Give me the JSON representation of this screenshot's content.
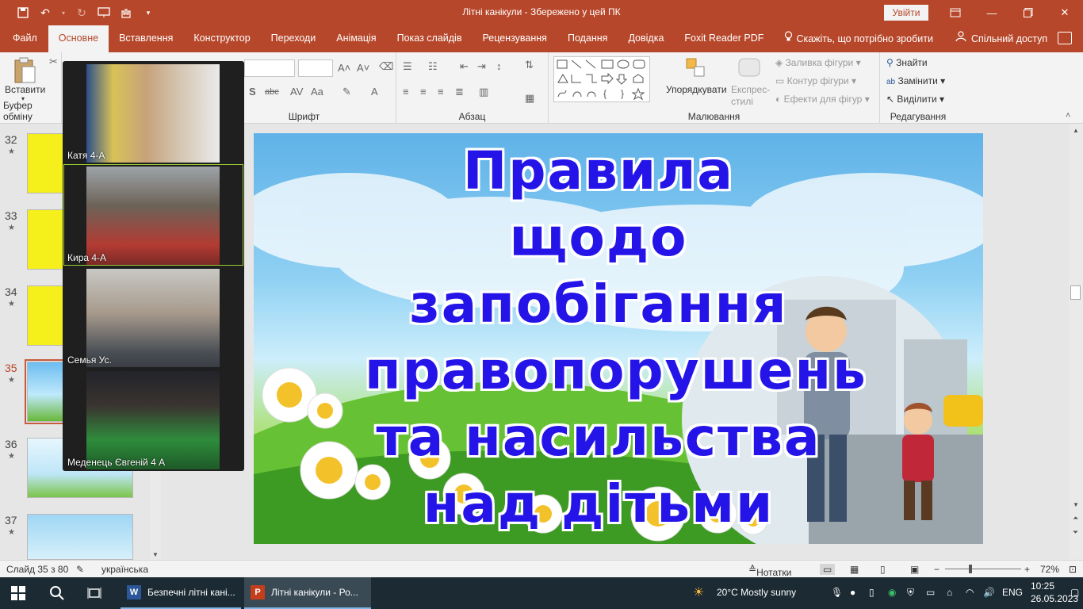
{
  "titlebar": {
    "document_title": "Літні канікули  -  Збережено у цей ПК",
    "signin_label": "Увійти",
    "accent_color": "#b7472a"
  },
  "tabs": [
    {
      "label": "Файл"
    },
    {
      "label": "Основне"
    },
    {
      "label": "Вставлення"
    },
    {
      "label": "Конструктор"
    },
    {
      "label": "Переходи"
    },
    {
      "label": "Анімація"
    },
    {
      "label": "Показ слайдів"
    },
    {
      "label": "Рецензування"
    },
    {
      "label": "Подання"
    },
    {
      "label": "Довідка"
    },
    {
      "label": "Foxit Reader PDF"
    }
  ],
  "tell_me": "Скажіть, що потрібно зробити",
  "share_label": "Спільний доступ",
  "ribbon": {
    "clipboard": {
      "paste_label": "Вставити",
      "group_label": "Буфер обміну"
    },
    "font": {
      "group_label": "Шрифт"
    },
    "paragraph": {
      "group_label": "Абзац"
    },
    "drawing": {
      "group_label": "Малювання",
      "arrange_label": "Упорядкувати",
      "quick_styles_label": "Експрес-стилі",
      "fill_label": "Заливка фігури",
      "outline_label": "Контур фігури",
      "effects_label": "Ефекти для фігур"
    },
    "editing": {
      "group_label": "Редагування",
      "find_label": "Знайти",
      "replace_label": "Замінити",
      "select_label": "Виділити"
    }
  },
  "thumbnails": [
    {
      "number": "32",
      "bg": "#f5ef1c"
    },
    {
      "number": "33",
      "bg": "#f5ef1c"
    },
    {
      "number": "34",
      "bg": "#f5ef1c"
    },
    {
      "number": "35",
      "bg": "#7fc7ef",
      "selected": true
    },
    {
      "number": "36",
      "bg": "#d9f0fb"
    },
    {
      "number": "37",
      "bg": "#bfe4f7"
    }
  ],
  "video": {
    "participants": [
      {
        "name": "Катя  4-А"
      },
      {
        "name": "Кира 4-А",
        "speaking": true
      },
      {
        "name": "Семья Ус."
      },
      {
        "name": "Меденець Євгеній 4 А"
      }
    ]
  },
  "slide": {
    "title_lines": [
      "Правила щодо",
      "запобігання",
      "правопорушень",
      "та насильства",
      "над дітьми"
    ],
    "title_color": "#2414e8"
  },
  "status": {
    "slide_counter": "Слайд 35 з 80",
    "language": "українська",
    "notes_label": "Нотатки",
    "zoom": "72%"
  },
  "taskbar": {
    "apps": [
      {
        "label": "Безпечні літні кані..."
      },
      {
        "label": "Літні канікули - Ро..."
      }
    ],
    "weather": "20°C  Mostly sunny",
    "language": "ENG",
    "time": "10:25",
    "date": "26.05.2023"
  }
}
